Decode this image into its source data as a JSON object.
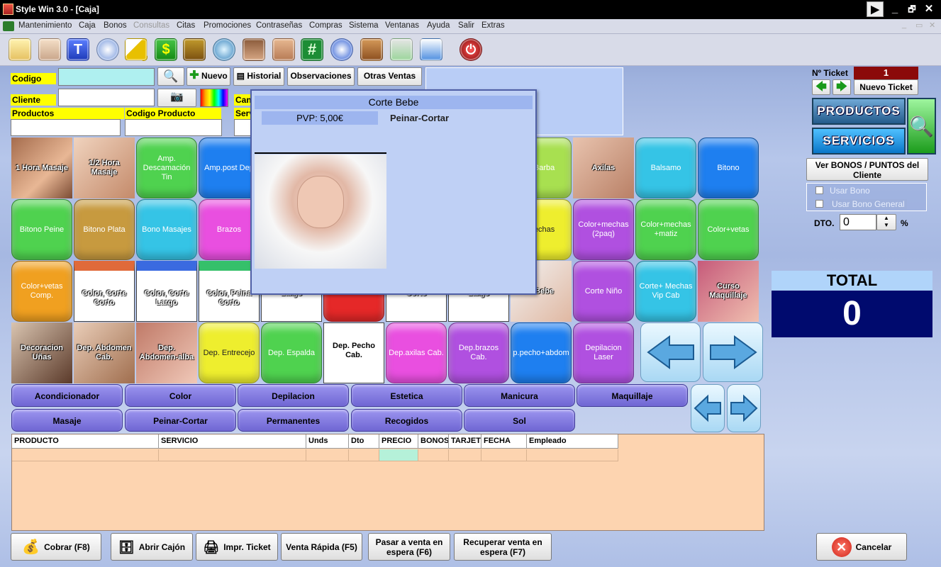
{
  "window": {
    "title": "Style Win 3.0 - [Caja]",
    "controls": [
      "▶",
      "_",
      "🗗",
      "✕"
    ]
  },
  "menu": {
    "items": [
      "Mantenimiento",
      "Caja",
      "Bonos",
      "Consultas",
      "Citas",
      "Promociones",
      "Contraseñas",
      "Compras",
      "Sistema",
      "Ventanas",
      "Ayuda",
      "Salir",
      "Extras"
    ],
    "disabled": [
      "Consultas"
    ]
  },
  "toolbar": {
    "icons": [
      "folder-icon",
      "customer-icon",
      "text-icon",
      "clock-icon",
      "pencil-icon",
      "money-icon",
      "bonus-card-icon",
      "watch-icon",
      "client-photo-icon",
      "eye-icon",
      "grid-icon",
      "search-globe-icon",
      "box-icon",
      "recycle-icon",
      "sync-icon",
      "power-icon"
    ]
  },
  "form": {
    "codigo_label": "Codigo",
    "cliente_label": "Cliente",
    "productos_label": "Productos",
    "codigo_producto_label": "Codigo Producto",
    "cantidad_label": "Can",
    "servicio_label": "Serv",
    "codigo_value": "",
    "cliente_value": "",
    "productos_value": "",
    "codigo_producto_value": "",
    "nuevo_label": "Nuevo",
    "historial_label": "Historial",
    "observaciones_label": "Observaciones",
    "otras_ventas_label": "Otras Ventas"
  },
  "popup": {
    "title": "Corte Bebe",
    "pvp": "PVP: 5,00€",
    "category": "Peinar-Cortar"
  },
  "ticket": {
    "label": "Nº Ticket",
    "number": "1",
    "nuevo_ticket": "Nuevo Ticket"
  },
  "right_panel": {
    "productos": "PRODUCTOS",
    "servicios": "SERVICIOS",
    "ver_bonos": "Ver BONOS / PUNTOS del Cliente",
    "usar_bono": "Usar Bono",
    "usar_bono_general": "Usar Bono General",
    "dto_label": "DTO.",
    "dto_value": "0",
    "pct": "%",
    "total_label": "TOTAL",
    "total_value": "0"
  },
  "services": [
    [
      "1 Hora Masaje",
      "1/2 Hora Masaje",
      "Amp. Descamación Tin",
      "Amp.post Dep",
      "",
      "",
      "",
      "",
      "o Barba",
      "Axilas",
      "Balsamo",
      "Bitono"
    ],
    [
      "Bitono Peine",
      "Bitono Plata",
      "Bono Masajes",
      "Brazos",
      "",
      "",
      "",
      "",
      "mechas",
      "Color+mechas (2paq)",
      "Color+mechas +matiz",
      "Color+vetas"
    ],
    [
      "Color+vetas Comp.",
      "Color, Corte Corto",
      "Color, Corte Largo",
      "Color, Peina Corto",
      "Largo",
      "Color",
      "Corto",
      "Largo",
      "e Bebe",
      "Corte Niño",
      "Corte+ Mechas Vip Cab",
      "Curso Maquillaje"
    ],
    [
      "Decoracion Uñas",
      "Dep. Abdomen Cab.",
      "Dep. Abdomen-alba",
      "Dep. Entrecejo",
      "Dep. Espalda",
      "Dep. Pecho Cab.",
      "Dep.axilas Cab.",
      "Dep.brazos Cab.",
      "p.pecho+abdom",
      "Depilacion Laser"
    ]
  ],
  "categories": [
    [
      "Acondicionador",
      "Color",
      "Depilacion",
      "Estetica",
      "Manicura",
      "Maquillaje"
    ],
    [
      "Masaje",
      "Peinar-Cortar",
      "Permanentes",
      "Recogidos",
      "Sol"
    ]
  ],
  "grid": {
    "columns": [
      "PRODUCTO",
      "SERVICIO",
      "Unds",
      "Dto",
      "PRECIO",
      "BONOS",
      "TARJET",
      "FECHA",
      "Empleado"
    ]
  },
  "bottom": {
    "cobrar": "Cobrar (F8)",
    "abrir_cajon": "Abrir Cajón",
    "impr_ticket": "Impr. Ticket",
    "venta_rapida": "Venta Rápida (F5)",
    "pasar_espera": "Pasar a venta en espera (F6)",
    "recuperar": "Recuperar venta en espera (F7)",
    "cancelar": "Cancelar"
  },
  "colors": {
    "green": "#4fd24f",
    "blue": "#1e7ff0",
    "cyan": "#35c4e6",
    "pink": "#e94fe0",
    "olive": "#c79a3f",
    "yellow": "#eeee2e",
    "purple": "#b050e0",
    "orange": "#f0a020",
    "red": "#e52828",
    "total_bg": "#000a6e"
  }
}
